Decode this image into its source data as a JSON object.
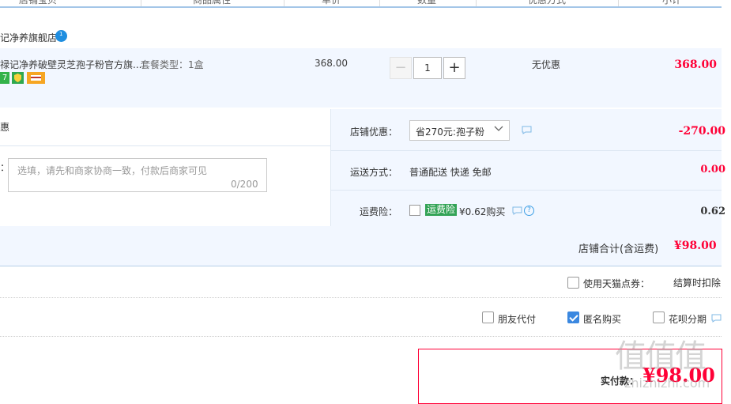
{
  "header": {
    "columns": [
      "店铺宝贝",
      "商品属性",
      "单价",
      "数量",
      "优惠方式",
      "小计"
    ]
  },
  "shop": {
    "name": "记净养旗舰店",
    "badge": "1"
  },
  "item": {
    "title": "禄记净养破壁灵芝孢子粉官方旗...",
    "spec": "套餐类型：1盒",
    "price": "368.00",
    "qty": "1",
    "minus": "−",
    "plus": "+",
    "discount": "无优惠",
    "subtotal": "368.00",
    "icons": [
      "7",
      "guarantee-icon",
      "card-icon"
    ]
  },
  "left": {
    "label1": "惠",
    "label2": "：",
    "message_placeholder": "选填，请先和商家协商一致，付款后商家可见",
    "message_count": "0/200"
  },
  "shop_discount": {
    "label": "店铺优惠：",
    "selected": "省270元:孢子粉",
    "amount": "-270.00"
  },
  "shipping": {
    "label": "运送方式：",
    "value": "普通配送 快递 免邮",
    "fee": "0.00"
  },
  "insurance": {
    "label": "运费险：",
    "tag": "运费险",
    "price": "¥0.62购买",
    "fee": "0.62",
    "help": "?"
  },
  "total": {
    "label": "店铺合计(含运费)",
    "value": "¥98.00"
  },
  "tmall_points": {
    "label": "使用天猫点券：",
    "note": "结算时扣除"
  },
  "options": {
    "friend_pay": "朋友代付",
    "anonymous": "匿名购买",
    "huabei": "花呗分期"
  },
  "payment": {
    "label": "实付款：",
    "value": "¥98.00"
  },
  "watermark": {
    "main": "值值值",
    "sub": "zhizhizhi.com"
  },
  "colors": {
    "price_red": "#ff0036",
    "row_bg": "#f2f7ff",
    "accent_blue": "#3b88e0"
  }
}
